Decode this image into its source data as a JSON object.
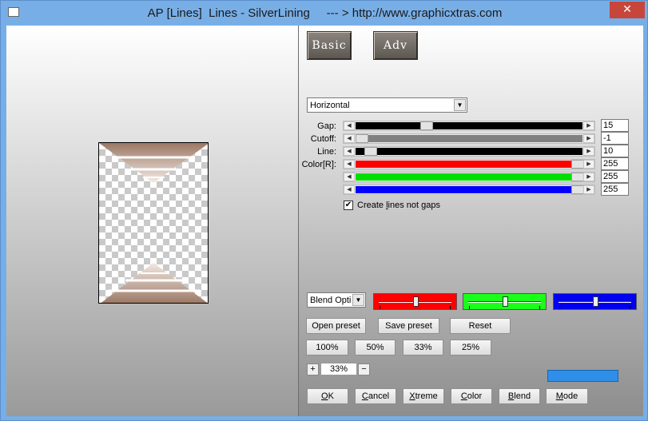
{
  "window": {
    "title": "AP [Lines]  Lines - SilverLining     --- > http://www.graphicxtras.com",
    "close_glyph": "✕"
  },
  "modes": {
    "basic_label": "Basic",
    "adv_label": "Adv"
  },
  "direction": {
    "value": "Horizontal"
  },
  "sliders": [
    {
      "label": "Gap:",
      "value": "15",
      "color": "#000000",
      "thumb": 0.3
    },
    {
      "label": "Cutoff:",
      "value": "-1",
      "color": "#808080",
      "thumb": 0.0
    },
    {
      "label": "Line:",
      "value": "10",
      "color": "#000000",
      "thumb": 0.04
    },
    {
      "label": "Color[R]:",
      "value": "255",
      "color": "#ff0000",
      "thumb": 1.0
    },
    {
      "label": "",
      "value": "255",
      "color": "#00e000",
      "thumb": 1.0
    },
    {
      "label": "",
      "value": "255",
      "color": "#0000ff",
      "thumb": 1.0
    }
  ],
  "create_lines": {
    "label": "Create lines not gaps",
    "underline_char": "l",
    "checked": true,
    "check_glyph": "✔"
  },
  "blend": {
    "select_value": "Blend Optio",
    "panels": [
      {
        "color": "#ff0000",
        "level": 0.5
      },
      {
        "color": "#1aff1a",
        "level": 0.5
      },
      {
        "color": "#0000ee",
        "level": 0.5
      }
    ]
  },
  "preset": {
    "open": "Open preset",
    "save": "Save preset",
    "reset": "Reset"
  },
  "zoom_buttons": [
    "100%",
    "50%",
    "33%",
    "25%"
  ],
  "zoom": {
    "plus": "+",
    "minus": "−",
    "value": "33%"
  },
  "indicator_color": "#2f8fe8",
  "bottom_buttons": {
    "ok": {
      "u": "O",
      "rest": "K"
    },
    "cancel": {
      "pre": "",
      "u": "C",
      "rest": "ancel"
    },
    "xtreme": {
      "pre": "",
      "u": "X",
      "rest": "treme"
    },
    "color": {
      "pre": "",
      "u": "C",
      "rest": "olor"
    },
    "blend": {
      "pre": "",
      "u": "B",
      "rest": "lend"
    },
    "mode": {
      "pre": "",
      "u": "M",
      "rest": "ode"
    }
  }
}
